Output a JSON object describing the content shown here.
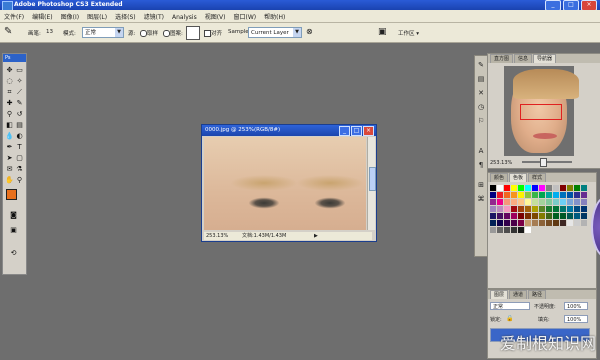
{
  "window": {
    "title": "Adobe Photoshop CS3 Extended",
    "min": "_",
    "max": "□",
    "close": "×"
  },
  "menu": [
    "文件(F)",
    "编辑(E)",
    "图像(I)",
    "图层(L)",
    "选择(S)",
    "滤镜(T)",
    "Analysis",
    "视图(V)",
    "窗口(W)",
    "帮助(H)"
  ],
  "options": {
    "brush_label": "画笔:",
    "brush_size": "13",
    "mode_label": "模式:",
    "mode_value": "正常",
    "source_label": "源:",
    "sampled": "取样",
    "pattern": "图案:",
    "aligned": "对齐",
    "sample_label": "Sample:",
    "sample_value": "Current Layer",
    "workspace": "工作区 ▾"
  },
  "toolbox": {
    "header": "Ps"
  },
  "document": {
    "title": "0000.jpg @ 253%(RGB/8#)",
    "zoom": "253.13%",
    "doc_info": "文档:1.43M/1.43M"
  },
  "navigator": {
    "tabs": [
      "直方图",
      "信息",
      "导航器"
    ],
    "zoom": "253.13%"
  },
  "swatches": {
    "tabs": [
      "颜色",
      "色板",
      "样式"
    ],
    "colors": [
      "#000000",
      "#ffffff",
      "#ff0000",
      "#ffff00",
      "#00ff00",
      "#00ffff",
      "#0000ff",
      "#ff00ff",
      "#808080",
      "#c0c0c0",
      "#800000",
      "#808000",
      "#008000",
      "#008080",
      "#000080",
      "#ed1c24",
      "#f26522",
      "#f7941d",
      "#fff200",
      "#8dc63f",
      "#39b54a",
      "#00a651",
      "#00a99d",
      "#00aeef",
      "#0072bc",
      "#0054a6",
      "#2e3192",
      "#662d91",
      "#92278f",
      "#ec008c",
      "#f69679",
      "#f9ad81",
      "#fdc689",
      "#fff799",
      "#c4df9b",
      "#a3d39c",
      "#82ca9d",
      "#7accc8",
      "#6dcff6",
      "#7da7d9",
      "#8393ca",
      "#8781bd",
      "#a186be",
      "#bd8cbf",
      "#f49ac1",
      "#9e0b0f",
      "#a0410d",
      "#a3620a",
      "#aba000",
      "#598527",
      "#197b30",
      "#007236",
      "#00746b",
      "#0076a3",
      "#004a80",
      "#003471",
      "#1b1464",
      "#440e62",
      "#630460",
      "#9e005d",
      "#790000",
      "#7b2e00",
      "#7d4900",
      "#827b00",
      "#406618",
      "#005e20",
      "#005826",
      "#005952",
      "#005b7f",
      "#003663",
      "#002157",
      "#0d004c",
      "#32004b",
      "#4b0049",
      "#7b0046",
      "#c69c6d",
      "#a67c52",
      "#8c6239",
      "#754c24",
      "#603913",
      "#3e2723",
      "#e6e6e6",
      "#cccccc",
      "#b3b3b3",
      "#999999",
      "#666666",
      "#4d4d4d",
      "#333333",
      "#1a1a1a",
      "#ffffff"
    ]
  },
  "layers": {
    "tabs": [
      "图层",
      "通道",
      "路径"
    ],
    "blend": "正常",
    "opacity_label": "不透明度:",
    "opacity": "100%",
    "lock_label": "锁定:",
    "fill_label": "填充:",
    "fill": "100%"
  },
  "watermark": "爱制根知识网"
}
